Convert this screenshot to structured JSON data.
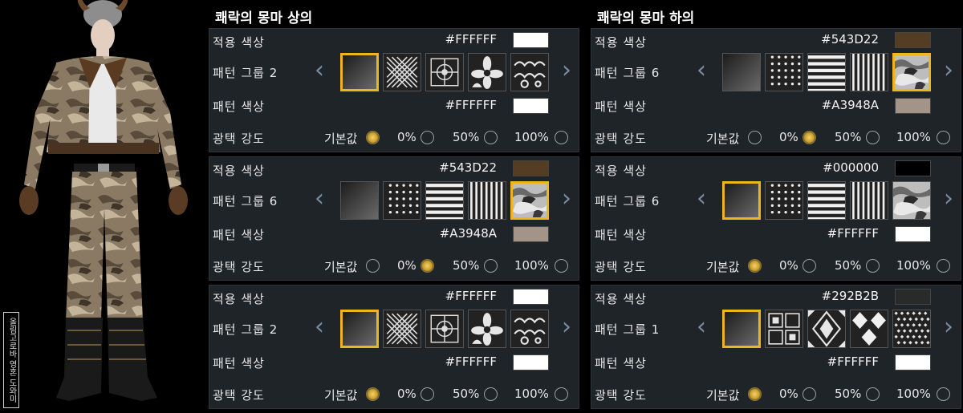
{
  "watermark": "올림고로바 영혼 도와미",
  "panels": [
    {
      "title": "쾌락의 몽마 상의",
      "groups": [
        {
          "apply_color_label": "적용 색상",
          "apply_color_hex": "#FFFFFF",
          "apply_color": "#FFFFFF",
          "pattern_group_label": "패턴 그룹 2",
          "patterns": [
            "gradient",
            "greek-key",
            "floral-tile",
            "flower",
            "cloud"
          ],
          "selected_pattern": 0,
          "pattern_color_label": "패턴 색상",
          "pattern_color_hex": "#FFFFFF",
          "pattern_color": "#FFFFFF",
          "gloss_label": "광택 강도",
          "gloss_options": [
            "기본값",
            "0%",
            "50%",
            "100%"
          ],
          "gloss_selected": 0
        },
        {
          "apply_color_label": "적용 색상",
          "apply_color_hex": "#543D22",
          "apply_color": "#543D22",
          "pattern_group_label": "패턴 그룹 6",
          "patterns": [
            "gradient",
            "dots",
            "h-stripes",
            "v-stripes",
            "camo"
          ],
          "selected_pattern": 4,
          "pattern_color_label": "패턴 색상",
          "pattern_color_hex": "#A3948A",
          "pattern_color": "#A3948A",
          "gloss_label": "광택 강도",
          "gloss_options": [
            "기본값",
            "0%",
            "50%",
            "100%"
          ],
          "gloss_selected": 1
        },
        {
          "apply_color_label": "적용 색상",
          "apply_color_hex": "#FFFFFF",
          "apply_color": "#FFFFFF",
          "pattern_group_label": "패턴 그룹 2",
          "patterns": [
            "gradient",
            "greek-key",
            "floral-tile",
            "flower",
            "cloud"
          ],
          "selected_pattern": 0,
          "pattern_color_label": "패턴 색상",
          "pattern_color_hex": "#FFFFFF",
          "pattern_color": "#FFFFFF",
          "gloss_label": "광택 강도",
          "gloss_options": [
            "기본값",
            "0%",
            "50%",
            "100%"
          ],
          "gloss_selected": 0
        }
      ]
    },
    {
      "title": "쾌락의 몽마 하의",
      "groups": [
        {
          "apply_color_label": "적용 색상",
          "apply_color_hex": "#543D22",
          "apply_color": "#543D22",
          "pattern_group_label": "패턴 그룹 6",
          "patterns": [
            "gradient",
            "dots",
            "h-stripes",
            "v-stripes",
            "camo"
          ],
          "selected_pattern": 4,
          "pattern_color_label": "패턴 색상",
          "pattern_color_hex": "#A3948A",
          "pattern_color": "#A3948A",
          "gloss_label": "광택 강도",
          "gloss_options": [
            "기본값",
            "0%",
            "50%",
            "100%"
          ],
          "gloss_selected": 1
        },
        {
          "apply_color_label": "적용 색상",
          "apply_color_hex": "#000000",
          "apply_color": "#000000",
          "pattern_group_label": "패턴 그룹 6",
          "patterns": [
            "gradient",
            "dots",
            "h-stripes",
            "v-stripes",
            "camo"
          ],
          "selected_pattern": 0,
          "pattern_color_label": "패턴 색상",
          "pattern_color_hex": "#FFFFFF",
          "pattern_color": "#FFFFFF",
          "gloss_label": "광택 강도",
          "gloss_options": [
            "기본값",
            "0%",
            "50%",
            "100%"
          ],
          "gloss_selected": 0
        },
        {
          "apply_color_label": "적용 색상",
          "apply_color_hex": "#292B2B",
          "apply_color": "#292B2B",
          "pattern_group_label": "패턴 그룹 1",
          "patterns": [
            "gradient",
            "tile-grid",
            "diamond",
            "argyle",
            "weave"
          ],
          "selected_pattern": 0,
          "pattern_color_label": "패턴 색상",
          "pattern_color_hex": "#FFFFFF",
          "pattern_color": "#FFFFFF",
          "gloss_label": "광택 강도",
          "gloss_options": [
            "기본값",
            "0%",
            "50%",
            "100%"
          ],
          "gloss_selected": 0
        }
      ]
    }
  ]
}
